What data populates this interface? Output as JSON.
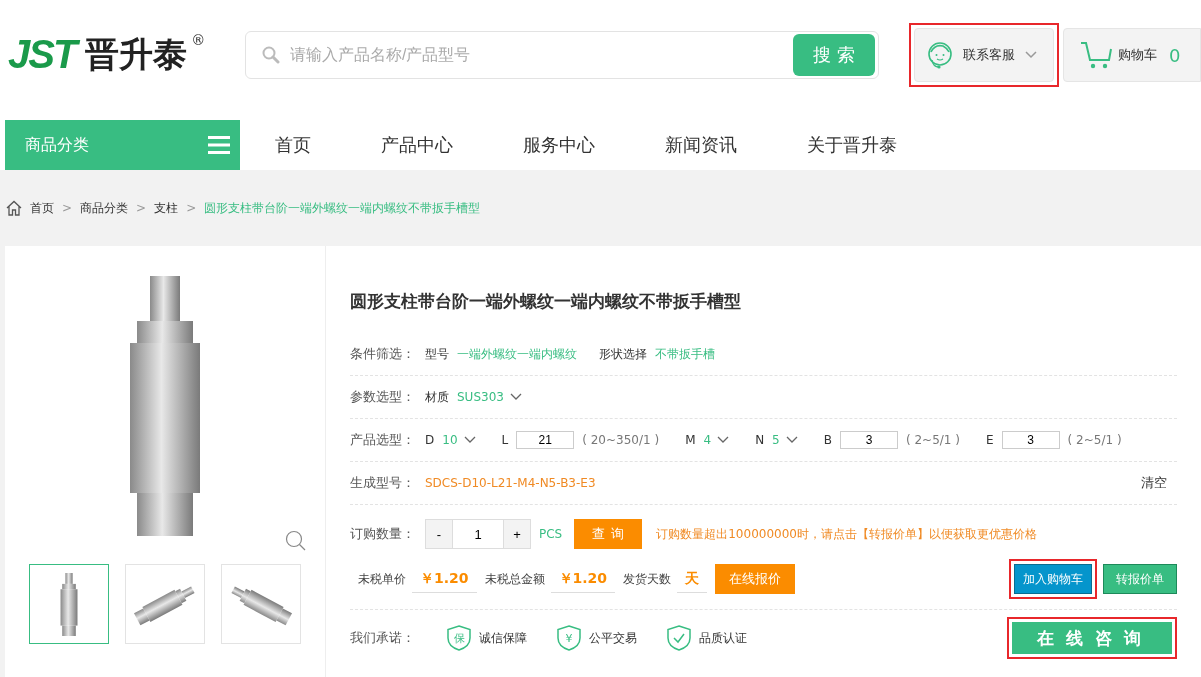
{
  "header": {
    "logo": {
      "letters": "JST",
      "name": "晋升泰",
      "mark": "®"
    },
    "search": {
      "placeholder": "请输入产品名称/产品型号",
      "button": "搜索"
    },
    "contact": {
      "label": "联系客服",
      "highlighted": true
    },
    "cart": {
      "label": "购物车",
      "count": "0"
    }
  },
  "nav": {
    "category": "商品分类",
    "items": [
      "首页",
      "产品中心",
      "服务中心",
      "新闻资讯",
      "关于晋升泰"
    ]
  },
  "breadcrumb": [
    {
      "label": "首页",
      "current": false
    },
    {
      "separator": ">",
      "label": "商品分类",
      "current": false
    },
    {
      "separator": ">",
      "label": "支柱",
      "current": false
    },
    {
      "separator": ">",
      "label": "圆形支柱带台阶一端外螺纹一端内螺纹不带扳手槽型",
      "current": true
    }
  ],
  "gallery": {
    "thumbnails": [
      {
        "selected": true
      },
      {
        "selected": false
      },
      {
        "selected": false
      }
    ]
  },
  "product": {
    "title": "圆形支柱带台阶一端外螺纹一端内螺纹不带扳手槽型",
    "filters": {
      "label": "条件筛选：",
      "items": [
        {
          "name": "型号",
          "value": "一端外螺纹一端内螺纹"
        },
        {
          "name": "形状选择",
          "value": "不带扳手槽"
        }
      ]
    },
    "params": {
      "label": "参数选型：",
      "items": [
        {
          "kind": "select",
          "name": "材质",
          "value": "SUS303"
        }
      ]
    },
    "selection": {
      "label": "产品选型：",
      "items": [
        {
          "kind": "select",
          "name": "D",
          "value": "10"
        },
        {
          "kind": "input",
          "name": "L",
          "value": "21",
          "range": "( 20~350/1 )"
        },
        {
          "kind": "select",
          "name": "M",
          "value": "4"
        },
        {
          "kind": "select",
          "name": "N",
          "value": "5"
        },
        {
          "kind": "input",
          "name": "B",
          "value": "3",
          "range": "( 2~5/1 )"
        },
        {
          "kind": "input",
          "name": "E",
          "value": "3",
          "range": "( 2~5/1 )"
        }
      ]
    },
    "model": {
      "label": "生成型号：",
      "value": "SDCS-D10-L21-M4-N5-B3-E3",
      "clear": "清空"
    },
    "order": {
      "label": "订购数量：",
      "minus": "-",
      "quantity": "1",
      "plus": "+",
      "unit": "PCS",
      "query": "查询",
      "notice": "订购数量超出100000000时，请点击【转报价单】以便获取更优惠价格"
    },
    "prices": [
      {
        "label": "未税单价",
        "value": "￥1.20"
      },
      {
        "label": "未税总金额",
        "value": "￥1.20"
      },
      {
        "label": "发货天数",
        "value": "天"
      }
    ],
    "quote": "在线报价",
    "add_to_cart": {
      "label": "加入购物车",
      "highlighted": true
    },
    "transfer": "转报价单",
    "promise": {
      "label": "我们承诺：",
      "items": [
        {
          "glyph": "保",
          "label": "诚信保障"
        },
        {
          "glyph": "¥",
          "label": "公平交易"
        },
        {
          "label": "品质认证"
        }
      ]
    },
    "consult": {
      "label": "在线咨询",
      "highlighted": true
    }
  }
}
